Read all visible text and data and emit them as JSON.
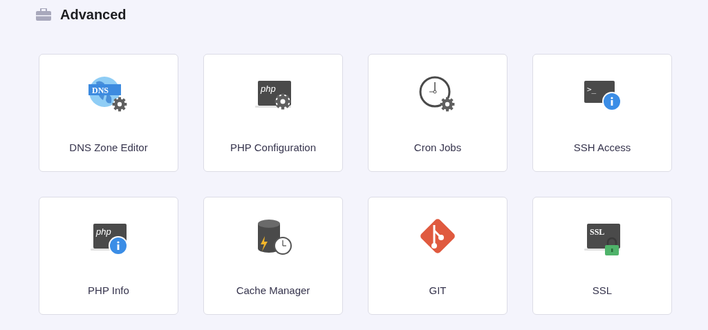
{
  "section": {
    "title": "Advanced"
  },
  "tools": [
    {
      "label": "DNS Zone Editor",
      "kind": "dns",
      "icon_text": "DNS"
    },
    {
      "label": "PHP Configuration",
      "kind": "php-config",
      "icon_text": "php"
    },
    {
      "label": "Cron Jobs",
      "kind": "cron"
    },
    {
      "label": "SSH Access",
      "kind": "ssh",
      "icon_text": ">_"
    },
    {
      "label": "PHP Info",
      "kind": "php-info",
      "icon_text": "php"
    },
    {
      "label": "Cache Manager",
      "kind": "cache"
    },
    {
      "label": "GIT",
      "kind": "git"
    },
    {
      "label": "SSL",
      "kind": "ssl",
      "icon_text": "SSL"
    }
  ]
}
